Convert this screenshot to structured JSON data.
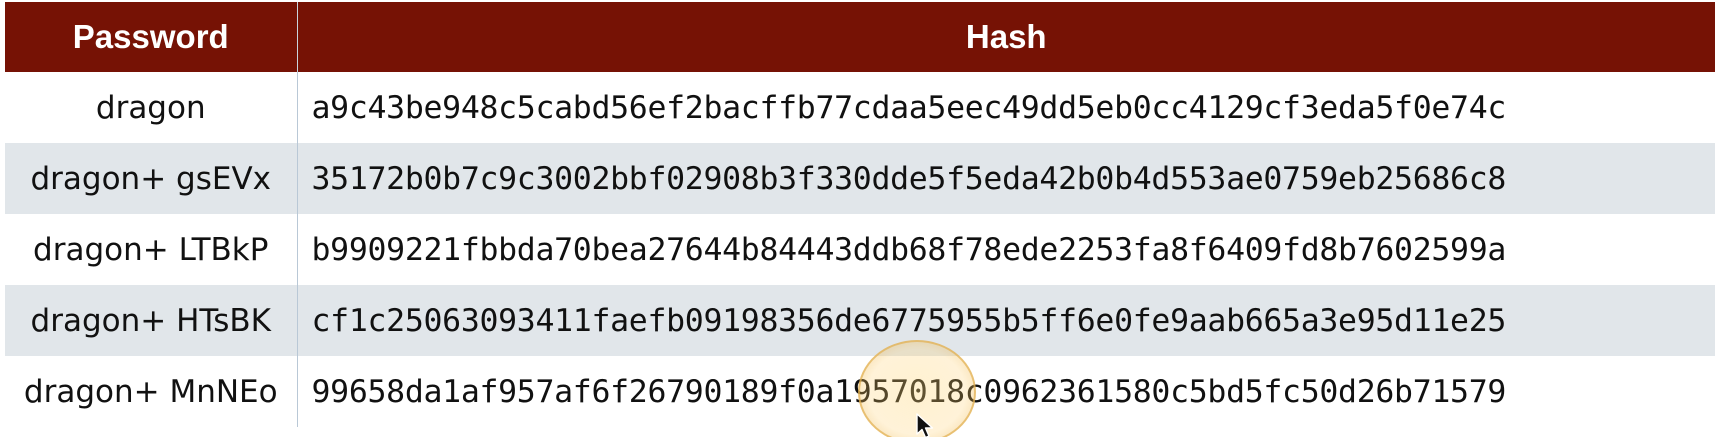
{
  "table": {
    "headers": {
      "password": "Password",
      "hash": "Hash"
    },
    "rows": [
      {
        "password": "dragon",
        "hash": "a9c43be948c5cabd56ef2bacffb77cdaa5eec49dd5eb0cc4129cf3eda5f0e74c"
      },
      {
        "password": "dragon+ gsEVx",
        "hash": "35172b0b7c9c3002bbf02908b3f330dde5f5eda42b0b4d553ae0759eb25686c8"
      },
      {
        "password": "dragon+ LTBkP",
        "hash": "b9909221fbbda70bea27644b84443ddb68f78ede2253fa8f6409fd8b7602599a"
      },
      {
        "password": "dragon+ HTsBK",
        "hash": "cf1c25063093411faefb09198356de6775955b5ff6e0fe9aab665a3e95d11e25"
      },
      {
        "password": "dragon+ MnNEo",
        "hash": "99658da1af957af6f26790189f0a1957018c0962361580c5bd5fc50d26b71579"
      }
    ]
  },
  "colors": {
    "header_background": "#761205",
    "header_text": "#ffffff",
    "row_alt_background": "#e1e6ea"
  },
  "icons": {
    "cursor": "mouse-pointer-icon",
    "highlight": "click-highlight-icon"
  }
}
